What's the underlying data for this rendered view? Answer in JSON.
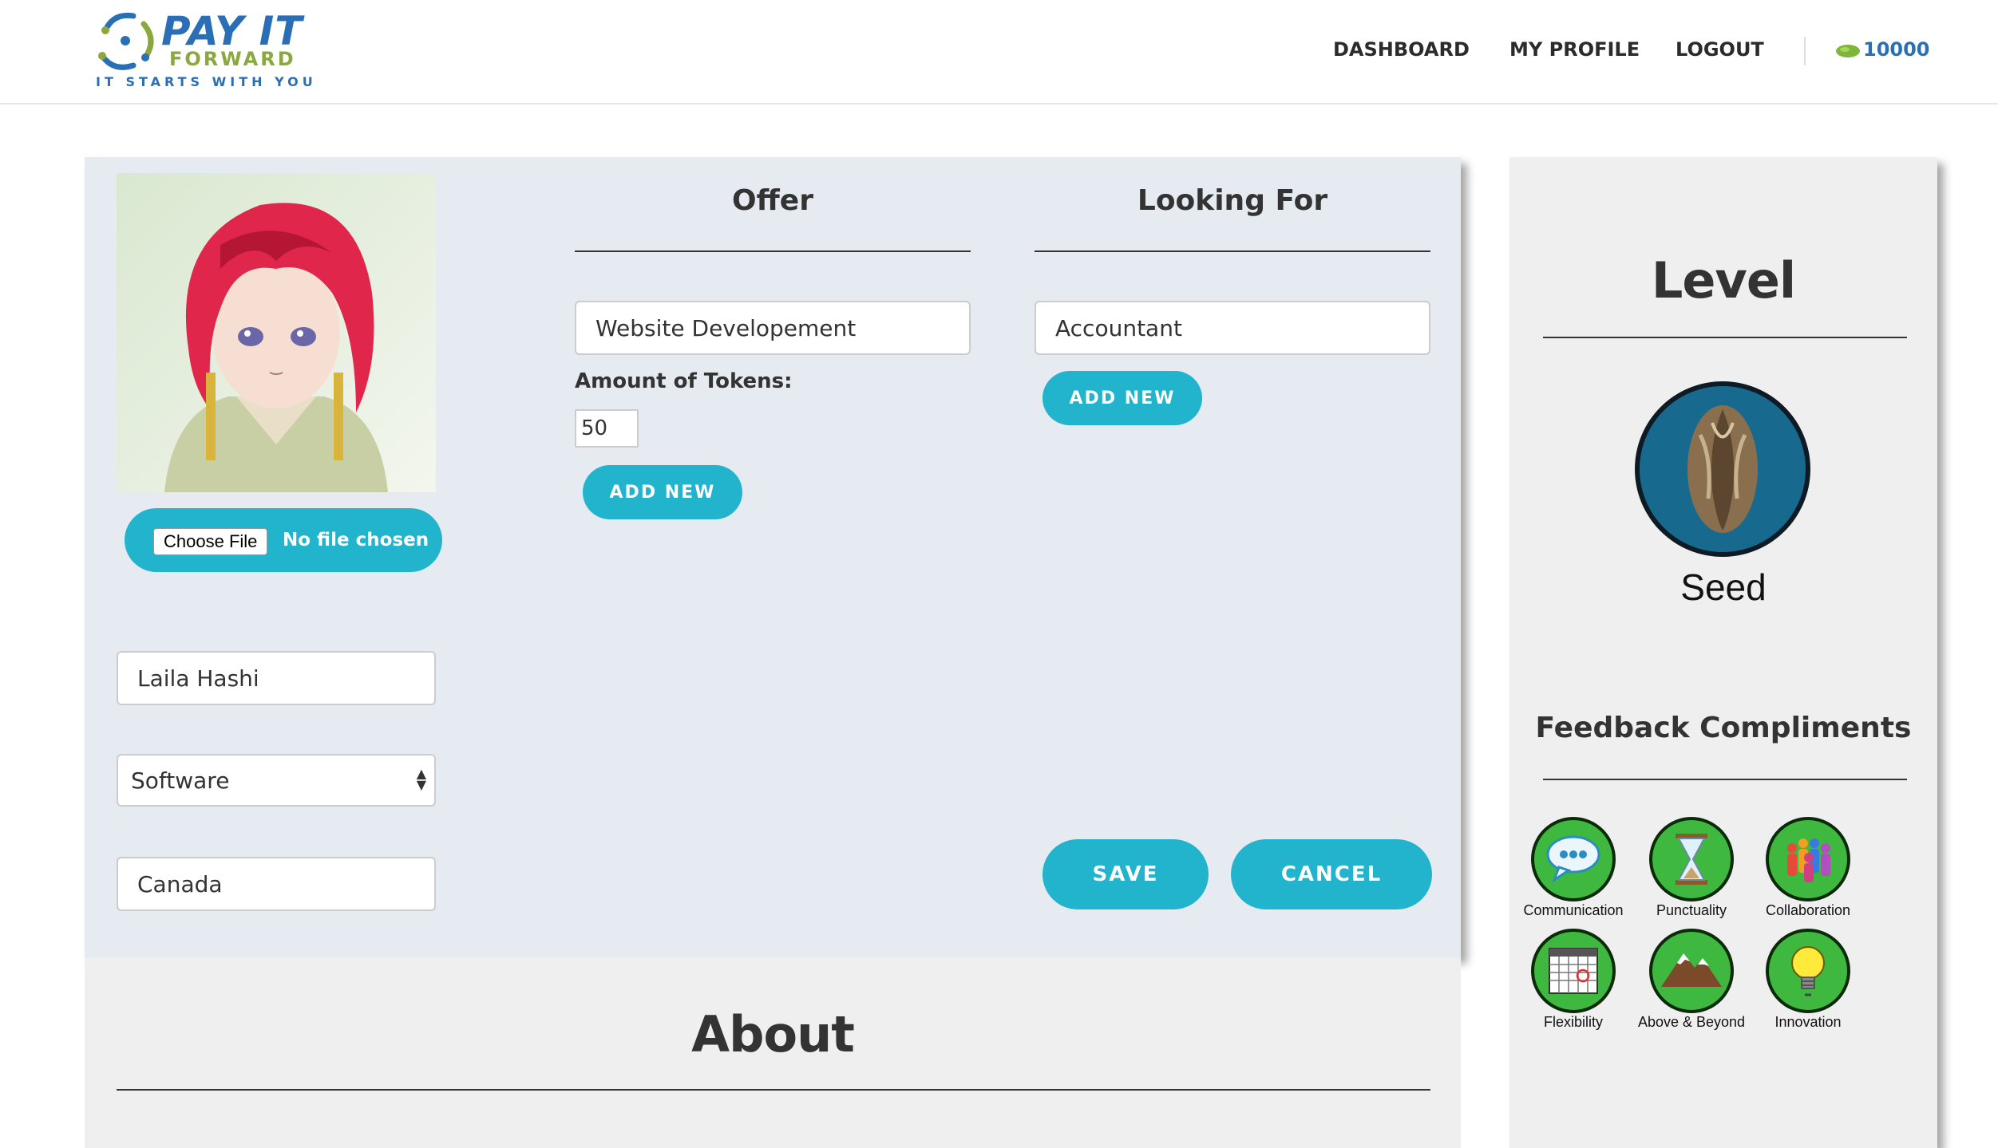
{
  "header": {
    "logo": {
      "line1": "PAY IT",
      "line2": "FORWARD",
      "tagline": "IT STARTS WITH YOU"
    },
    "nav": {
      "dashboard": "DASHBOARD",
      "profile": "MY PROFILE",
      "logout": "LOGOUT"
    },
    "tokens": "10000",
    "token_icon": "bean-icon"
  },
  "profile": {
    "file_button": "Choose File",
    "file_status": "No file chosen",
    "name": "Laila Hashi",
    "category": "Software",
    "country": "Canada"
  },
  "offer": {
    "title": "Offer",
    "skill": "Website Developement",
    "tokens_label": "Amount of Tokens:",
    "tokens_value": "50",
    "add_label": "ADD NEW"
  },
  "looking_for": {
    "title": "Looking For",
    "skill": "Accountant",
    "add_label": "ADD NEW"
  },
  "actions": {
    "save": "SAVE",
    "cancel": "CANCEL"
  },
  "about": {
    "title": "About"
  },
  "sidebar": {
    "level_title": "Level",
    "level_name": "Seed",
    "feedback_title": "Feedback Compliments",
    "badges": [
      {
        "label": "Communication",
        "icon": "speech-bubble-icon"
      },
      {
        "label": "Punctuality",
        "icon": "hourglass-icon"
      },
      {
        "label": "Collaboration",
        "icon": "people-icon"
      },
      {
        "label": "Flexibility",
        "icon": "calendar-icon"
      },
      {
        "label": "Above & Beyond",
        "icon": "mountain-icon"
      },
      {
        "label": "Innovation",
        "icon": "lightbulb-icon"
      }
    ]
  },
  "colors": {
    "accent": "#22b3cd",
    "brand_blue": "#2a6fb5",
    "brand_green": "#8aa83d",
    "badge_green": "#3fb83f",
    "panel": "#e5ebf1"
  }
}
